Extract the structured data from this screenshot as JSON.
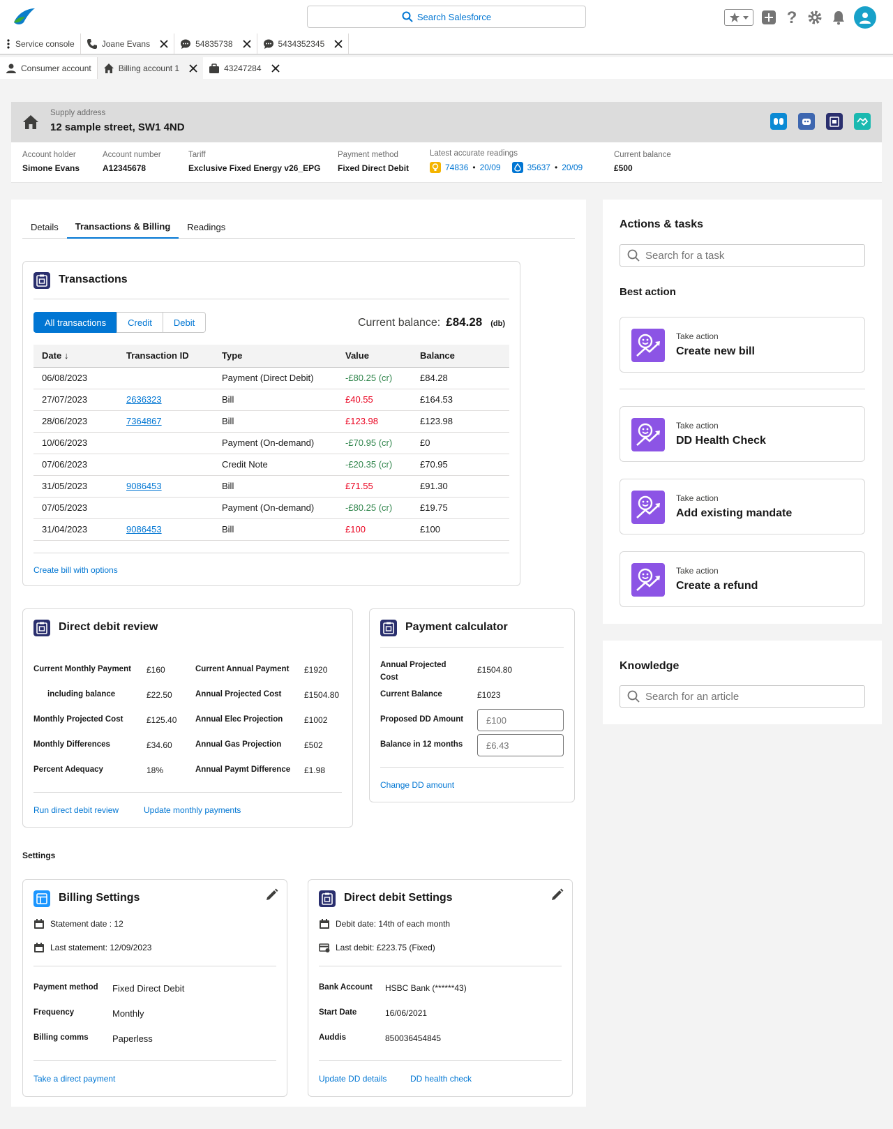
{
  "topbar": {
    "search_label": "Search Salesforce"
  },
  "tabs_row1": [
    {
      "label": "Service console",
      "icon": "menu-dots-icon"
    },
    {
      "label": "Joane Evans",
      "icon": "phone-icon"
    },
    {
      "label": "54835738",
      "icon": "chat-icon"
    },
    {
      "label": "5434352345",
      "icon": "chat-icon"
    }
  ],
  "tabs_row2": [
    {
      "label": "Consumer account",
      "icon": "person-icon"
    },
    {
      "label": "Billing account 1",
      "icon": "home-icon"
    },
    {
      "label": "43247284",
      "icon": "briefcase-icon"
    }
  ],
  "supply": {
    "label": "Supply address",
    "address": "12 sample street, SW1 4ND"
  },
  "account": {
    "holder_label": "Account holder",
    "holder": "Simone Evans",
    "number_label": "Account number",
    "number": "A12345678",
    "tariff_label": "Tariff",
    "tariff": "Exclusive Fixed Energy v26_EPG",
    "payment_label": "Payment method",
    "payment": "Fixed Direct Debit",
    "readings_label": "Latest accurate readings",
    "reading1_value": "74836",
    "reading1_date": "20/09",
    "reading2_value": "35637",
    "reading2_date": "20/09",
    "balance_label": "Current balance",
    "balance": "£500"
  },
  "main_tabs": [
    "Details",
    "Transactions & Billing",
    "Readings"
  ],
  "transactions": {
    "title": "Transactions",
    "filters": [
      "All transactions",
      "Credit",
      "Debit"
    ],
    "balance_label": "Current balance:",
    "balance_value": "£84.28",
    "balance_suffix": "(db)",
    "headers": [
      "Date",
      "Transaction ID",
      "Type",
      "Value",
      "Balance"
    ],
    "rows": [
      {
        "date": "06/08/2023",
        "id": "",
        "type": "Payment (Direct Debit)",
        "value": "-£80.25 (cr)",
        "balance": "£84.28",
        "kind": "neg"
      },
      {
        "date": "27/07/2023",
        "id": "2636323",
        "type": "Bill",
        "value": "£40.55",
        "balance": "£164.53",
        "kind": "pos"
      },
      {
        "date": "28/06/2023",
        "id": "7364867",
        "type": "Bill",
        "value": "£123.98",
        "balance": "£123.98",
        "kind": "pos"
      },
      {
        "date": "10/06/2023",
        "id": "",
        "type": "Payment (On-demand)",
        "value": "-£70.95 (cr)",
        "balance": "£0",
        "kind": "neg"
      },
      {
        "date": "07/06/2023",
        "id": "",
        "type": "Credit Note",
        "value": "-£20.35 (cr)",
        "balance": "£70.95",
        "kind": "neg"
      },
      {
        "date": "31/05/2023",
        "id": "9086453",
        "type": "Bill",
        "value": "£71.55",
        "balance": "£91.30",
        "kind": "pos"
      },
      {
        "date": "07/05/2023",
        "id": "",
        "type": "Payment (On-demand)",
        "value": "-£80.25 (cr)",
        "balance": "£19.75",
        "kind": "neg"
      },
      {
        "date": "31/04/2023",
        "id": "9086453",
        "type": "Bill",
        "value": "£100",
        "balance": "£100",
        "kind": "pos"
      }
    ],
    "footer_link": "Create bill with options"
  },
  "dd_review": {
    "title": "Direct debit review",
    "left": [
      {
        "label": "Current Monthly Payment",
        "value": "£160"
      },
      {
        "label": "including balance",
        "value": "£22.50"
      },
      {
        "label": "Monthly Projected Cost",
        "value": "£125.40"
      },
      {
        "label": "Monthly Differences",
        "value": "£34.60"
      },
      {
        "label": "Percent Adequacy",
        "value": "18%"
      }
    ],
    "right": [
      {
        "label": "Current Annual Payment",
        "value": "£1920"
      },
      {
        "label": "Annual Projected Cost",
        "value": "£1504.80"
      },
      {
        "label": "Annual Elec Projection",
        "value": "£1002"
      },
      {
        "label": "Annual Gas Projection",
        "value": "£502"
      },
      {
        "label": "Annual Paymt Difference",
        "value": "£1.98"
      }
    ],
    "link1": "Run direct debit review",
    "link2": "Update monthly payments"
  },
  "calculator": {
    "title": "Payment calculator",
    "annual_label": "Annual Projected Cost",
    "annual_value": "£1504.80",
    "current_label": "Current Balance",
    "current_value": "£1023",
    "proposed_label": "Proposed DD Amount",
    "proposed_placeholder": "£100",
    "balance12_label": "Balance in 12 months",
    "balance12_placeholder": "£6.43",
    "link": "Change DD amount"
  },
  "settings": {
    "heading": "Settings",
    "billing": {
      "title": "Billing Settings",
      "statement_date": "Statement date : 12",
      "last_statement": "Last statement: 12/09/2023",
      "rows": [
        {
          "label": "Payment method",
          "value": "Fixed Direct Debit"
        },
        {
          "label": "Frequency",
          "value": "Monthly"
        },
        {
          "label": "Billing comms",
          "value": "Paperless"
        }
      ],
      "link": "Take a direct payment"
    },
    "dd": {
      "title": "Direct debit Settings",
      "debit_date": "Debit date: 14th of each month",
      "last_debit": "Last debit: £223.75  (Fixed)",
      "rows": [
        {
          "label": "Bank Account",
          "value": "HSBC Bank (******43)"
        },
        {
          "label": "Start Date",
          "value": "16/06/2021"
        },
        {
          "label": "Auddis",
          "value": "850036454845"
        }
      ],
      "link1": "Update DD details",
      "link2": "DD health check"
    }
  },
  "actions": {
    "title": "Actions & tasks",
    "search_placeholder": "Search for a task",
    "best_action": "Best action",
    "cards": [
      {
        "sub": "Take action",
        "title": "Create new bill"
      },
      {
        "sub": "Take action",
        "title": "DD Health Check"
      },
      {
        "sub": "Take action",
        "title": "Add existing mandate"
      },
      {
        "sub": "Take action",
        "title": "Create a refund"
      }
    ]
  },
  "knowledge": {
    "title": "Knowledge",
    "search_placeholder": "Search for an article"
  },
  "colors": {
    "brand": "#0176d3",
    "action": "#8c54e5",
    "negative": "#2e844a",
    "positive": "#ea001e"
  }
}
